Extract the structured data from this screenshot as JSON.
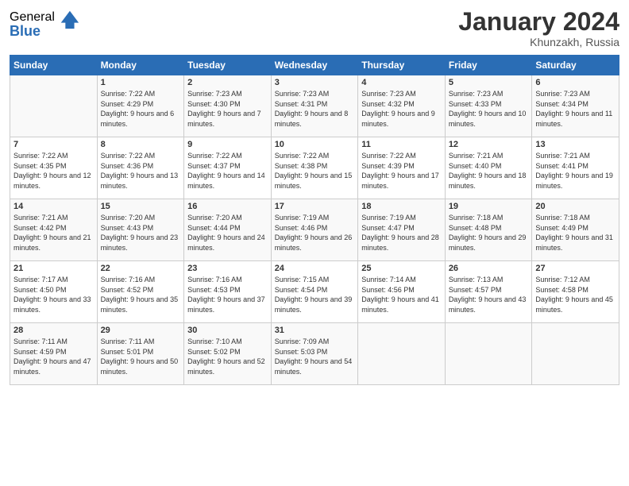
{
  "logo": {
    "general": "General",
    "blue": "Blue"
  },
  "header": {
    "month": "January 2024",
    "location": "Khunzakh, Russia"
  },
  "weekdays": [
    "Sunday",
    "Monday",
    "Tuesday",
    "Wednesday",
    "Thursday",
    "Friday",
    "Saturday"
  ],
  "weeks": [
    [
      {
        "day": "",
        "sunrise": "",
        "sunset": "",
        "daylight": ""
      },
      {
        "day": "1",
        "sunrise": "Sunrise: 7:22 AM",
        "sunset": "Sunset: 4:29 PM",
        "daylight": "Daylight: 9 hours and 6 minutes."
      },
      {
        "day": "2",
        "sunrise": "Sunrise: 7:23 AM",
        "sunset": "Sunset: 4:30 PM",
        "daylight": "Daylight: 9 hours and 7 minutes."
      },
      {
        "day": "3",
        "sunrise": "Sunrise: 7:23 AM",
        "sunset": "Sunset: 4:31 PM",
        "daylight": "Daylight: 9 hours and 8 minutes."
      },
      {
        "day": "4",
        "sunrise": "Sunrise: 7:23 AM",
        "sunset": "Sunset: 4:32 PM",
        "daylight": "Daylight: 9 hours and 9 minutes."
      },
      {
        "day": "5",
        "sunrise": "Sunrise: 7:23 AM",
        "sunset": "Sunset: 4:33 PM",
        "daylight": "Daylight: 9 hours and 10 minutes."
      },
      {
        "day": "6",
        "sunrise": "Sunrise: 7:23 AM",
        "sunset": "Sunset: 4:34 PM",
        "daylight": "Daylight: 9 hours and 11 minutes."
      }
    ],
    [
      {
        "day": "7",
        "sunrise": "Sunrise: 7:22 AM",
        "sunset": "Sunset: 4:35 PM",
        "daylight": "Daylight: 9 hours and 12 minutes."
      },
      {
        "day": "8",
        "sunrise": "Sunrise: 7:22 AM",
        "sunset": "Sunset: 4:36 PM",
        "daylight": "Daylight: 9 hours and 13 minutes."
      },
      {
        "day": "9",
        "sunrise": "Sunrise: 7:22 AM",
        "sunset": "Sunset: 4:37 PM",
        "daylight": "Daylight: 9 hours and 14 minutes."
      },
      {
        "day": "10",
        "sunrise": "Sunrise: 7:22 AM",
        "sunset": "Sunset: 4:38 PM",
        "daylight": "Daylight: 9 hours and 15 minutes."
      },
      {
        "day": "11",
        "sunrise": "Sunrise: 7:22 AM",
        "sunset": "Sunset: 4:39 PM",
        "daylight": "Daylight: 9 hours and 17 minutes."
      },
      {
        "day": "12",
        "sunrise": "Sunrise: 7:21 AM",
        "sunset": "Sunset: 4:40 PM",
        "daylight": "Daylight: 9 hours and 18 minutes."
      },
      {
        "day": "13",
        "sunrise": "Sunrise: 7:21 AM",
        "sunset": "Sunset: 4:41 PM",
        "daylight": "Daylight: 9 hours and 19 minutes."
      }
    ],
    [
      {
        "day": "14",
        "sunrise": "Sunrise: 7:21 AM",
        "sunset": "Sunset: 4:42 PM",
        "daylight": "Daylight: 9 hours and 21 minutes."
      },
      {
        "day": "15",
        "sunrise": "Sunrise: 7:20 AM",
        "sunset": "Sunset: 4:43 PM",
        "daylight": "Daylight: 9 hours and 23 minutes."
      },
      {
        "day": "16",
        "sunrise": "Sunrise: 7:20 AM",
        "sunset": "Sunset: 4:44 PM",
        "daylight": "Daylight: 9 hours and 24 minutes."
      },
      {
        "day": "17",
        "sunrise": "Sunrise: 7:19 AM",
        "sunset": "Sunset: 4:46 PM",
        "daylight": "Daylight: 9 hours and 26 minutes."
      },
      {
        "day": "18",
        "sunrise": "Sunrise: 7:19 AM",
        "sunset": "Sunset: 4:47 PM",
        "daylight": "Daylight: 9 hours and 28 minutes."
      },
      {
        "day": "19",
        "sunrise": "Sunrise: 7:18 AM",
        "sunset": "Sunset: 4:48 PM",
        "daylight": "Daylight: 9 hours and 29 minutes."
      },
      {
        "day": "20",
        "sunrise": "Sunrise: 7:18 AM",
        "sunset": "Sunset: 4:49 PM",
        "daylight": "Daylight: 9 hours and 31 minutes."
      }
    ],
    [
      {
        "day": "21",
        "sunrise": "Sunrise: 7:17 AM",
        "sunset": "Sunset: 4:50 PM",
        "daylight": "Daylight: 9 hours and 33 minutes."
      },
      {
        "day": "22",
        "sunrise": "Sunrise: 7:16 AM",
        "sunset": "Sunset: 4:52 PM",
        "daylight": "Daylight: 9 hours and 35 minutes."
      },
      {
        "day": "23",
        "sunrise": "Sunrise: 7:16 AM",
        "sunset": "Sunset: 4:53 PM",
        "daylight": "Daylight: 9 hours and 37 minutes."
      },
      {
        "day": "24",
        "sunrise": "Sunrise: 7:15 AM",
        "sunset": "Sunset: 4:54 PM",
        "daylight": "Daylight: 9 hours and 39 minutes."
      },
      {
        "day": "25",
        "sunrise": "Sunrise: 7:14 AM",
        "sunset": "Sunset: 4:56 PM",
        "daylight": "Daylight: 9 hours and 41 minutes."
      },
      {
        "day": "26",
        "sunrise": "Sunrise: 7:13 AM",
        "sunset": "Sunset: 4:57 PM",
        "daylight": "Daylight: 9 hours and 43 minutes."
      },
      {
        "day": "27",
        "sunrise": "Sunrise: 7:12 AM",
        "sunset": "Sunset: 4:58 PM",
        "daylight": "Daylight: 9 hours and 45 minutes."
      }
    ],
    [
      {
        "day": "28",
        "sunrise": "Sunrise: 7:11 AM",
        "sunset": "Sunset: 4:59 PM",
        "daylight": "Daylight: 9 hours and 47 minutes."
      },
      {
        "day": "29",
        "sunrise": "Sunrise: 7:11 AM",
        "sunset": "Sunset: 5:01 PM",
        "daylight": "Daylight: 9 hours and 50 minutes."
      },
      {
        "day": "30",
        "sunrise": "Sunrise: 7:10 AM",
        "sunset": "Sunset: 5:02 PM",
        "daylight": "Daylight: 9 hours and 52 minutes."
      },
      {
        "day": "31",
        "sunrise": "Sunrise: 7:09 AM",
        "sunset": "Sunset: 5:03 PM",
        "daylight": "Daylight: 9 hours and 54 minutes."
      },
      {
        "day": "",
        "sunrise": "",
        "sunset": "",
        "daylight": ""
      },
      {
        "day": "",
        "sunrise": "",
        "sunset": "",
        "daylight": ""
      },
      {
        "day": "",
        "sunrise": "",
        "sunset": "",
        "daylight": ""
      }
    ]
  ]
}
